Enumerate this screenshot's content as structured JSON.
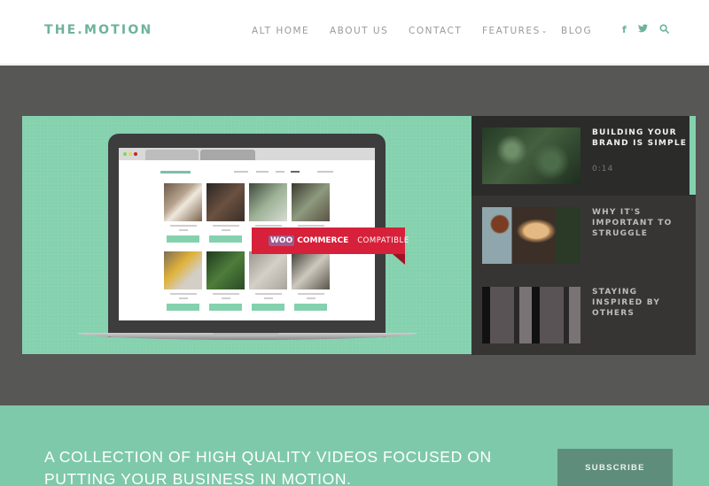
{
  "header": {
    "logo": "THE.MOTION",
    "nav": [
      {
        "label": "ALT HOME"
      },
      {
        "label": "ABOUT US"
      },
      {
        "label": "CONTACT"
      },
      {
        "label": "FEATURES",
        "has_dropdown": true
      },
      {
        "label": "BLOG"
      }
    ],
    "dropdown_glyph": "⌄",
    "social": [
      {
        "icon": "facebook-icon",
        "glyph": "f"
      },
      {
        "icon": "twitter-icon",
        "glyph": "🐦"
      },
      {
        "icon": "search-icon",
        "glyph": "⚲"
      }
    ]
  },
  "featured": {
    "badge_woo": "WOO",
    "badge_commerce": "COMMERCE",
    "badge_compatible": "COMPATIBLE"
  },
  "playlist": {
    "items": [
      {
        "title": "BUILDING YOUR BRAND IS SIMPLE",
        "duration": "0:14",
        "active": true
      },
      {
        "title": "WHY IT'S IMPORTANT TO STRUGGLE",
        "duration": "",
        "active": false
      },
      {
        "title": "STAYING INSPIRED BY OTHERS",
        "duration": "",
        "active": false
      }
    ]
  },
  "cta": {
    "text": "A COLLECTION OF HIGH QUALITY VIDEOS FOCUSED ON PUTTING YOUR BUSINESS IN MOTION.",
    "button": "SUBSCRIBE"
  },
  "colors": {
    "accent": "#7ec9aa",
    "logo": "#6db39b",
    "dark_band": "#575756",
    "playlist_bg": "#363534",
    "woo_red": "#d7203a",
    "subscribe_bg": "#5e8e7b"
  }
}
